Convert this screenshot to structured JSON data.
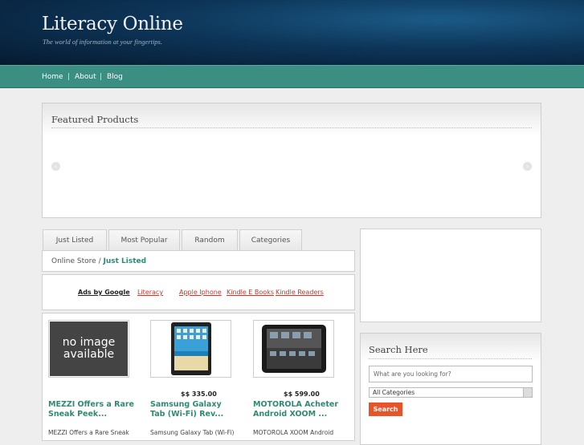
{
  "header": {
    "title": "Literacy Online",
    "tagline": "The world of information at your fingertips."
  },
  "nav": {
    "items": [
      "Home",
      "About",
      "Blog"
    ],
    "separator": "|"
  },
  "featured": {
    "title": "Featured Products",
    "prev_icon": "chevron-left-icon",
    "next_icon": "chevron-right-icon"
  },
  "tabs": [
    "Just Listed",
    "Most Popular",
    "Random",
    "Categories"
  ],
  "breadcrumb": {
    "root": "Online Store",
    "separator": "/",
    "current": "Just Listed"
  },
  "ads": {
    "label": "Ads by Google",
    "links": [
      "Literacy",
      "Apple Iphone",
      "Kindle E Books",
      "Kindle Readers"
    ]
  },
  "products": [
    {
      "image": "no image available",
      "price": "",
      "title": "MEZZI Offers a Rare Sneak Peek...",
      "desc": "MEZZI Offers a Rare Sneak"
    },
    {
      "image": "tablet",
      "price": "$$ 335.00",
      "title": "Samsung Galaxy Tab (Wi-Fi) Rev...",
      "desc": "Samsung Galaxy Tab (Wi-Fi)"
    },
    {
      "image": "tablet",
      "price": "$$ 599.00",
      "title": "MOTOROLA Acheter Android XOOM ...",
      "desc": "MOTOROLA XOOM Android"
    }
  ],
  "search": {
    "title": "Search Here",
    "placeholder": "What are you looking for?",
    "category_selected": "All Categories",
    "button_label": "Search"
  },
  "colors": {
    "nav_bg": "#3a8f82",
    "link_green": "#2f8a72",
    "search_button": "#e8542a"
  }
}
